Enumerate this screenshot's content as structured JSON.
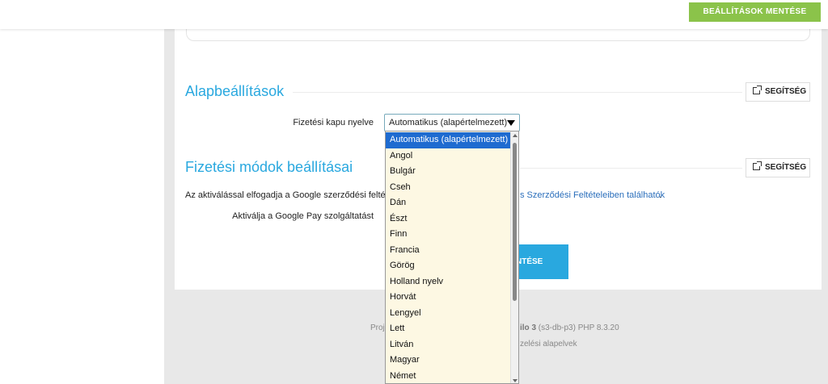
{
  "topbar": {
    "save_label": "BEÁLLÍTÁSOK MENTÉSE"
  },
  "sections": [
    {
      "title": "Alapbeállítások",
      "help_label": "SEGÍTSÉG"
    },
    {
      "title": "Fizetési módok beállításai",
      "help_label": "SEGÍTSÉG"
    }
  ],
  "language_field": {
    "label": "Fizetési kapu nyelve",
    "selected": "Automatikus (alapértelmezett)"
  },
  "notice": {
    "text": "Az aktiválással elfogadja a Google szerződési feltéte",
    "link_text": "s Szerződési Feltételeiben találhatók",
    "end": "."
  },
  "google_pay_label": "Aktiválja a Google Pay szolgáltatást",
  "save_button_label": "NTÉSE",
  "footer": {
    "left": "Proj",
    "bold_part": "ilo 3",
    "rest": " (s3-db-p3) PHP 8.3.20",
    "line2": "zelési alapelvek"
  },
  "dropdown_options": [
    "Automatikus (alapértelmezett)",
    "Angol",
    "Bulgár",
    "Cseh",
    "Dán",
    "Észt",
    "Finn",
    "Francia",
    "Görög",
    "Holland nyelv",
    "Horvát",
    "Lengyel",
    "Lett",
    "Litván",
    "Magyar",
    "Német"
  ],
  "colors": {
    "accent": "#29a8df",
    "save_green": "#8bc34a",
    "link": "#2a6ebb",
    "selected_option": "#1e6bd0"
  },
  "icons": {
    "help": "external-link-icon",
    "select": "caret-down-icon"
  }
}
